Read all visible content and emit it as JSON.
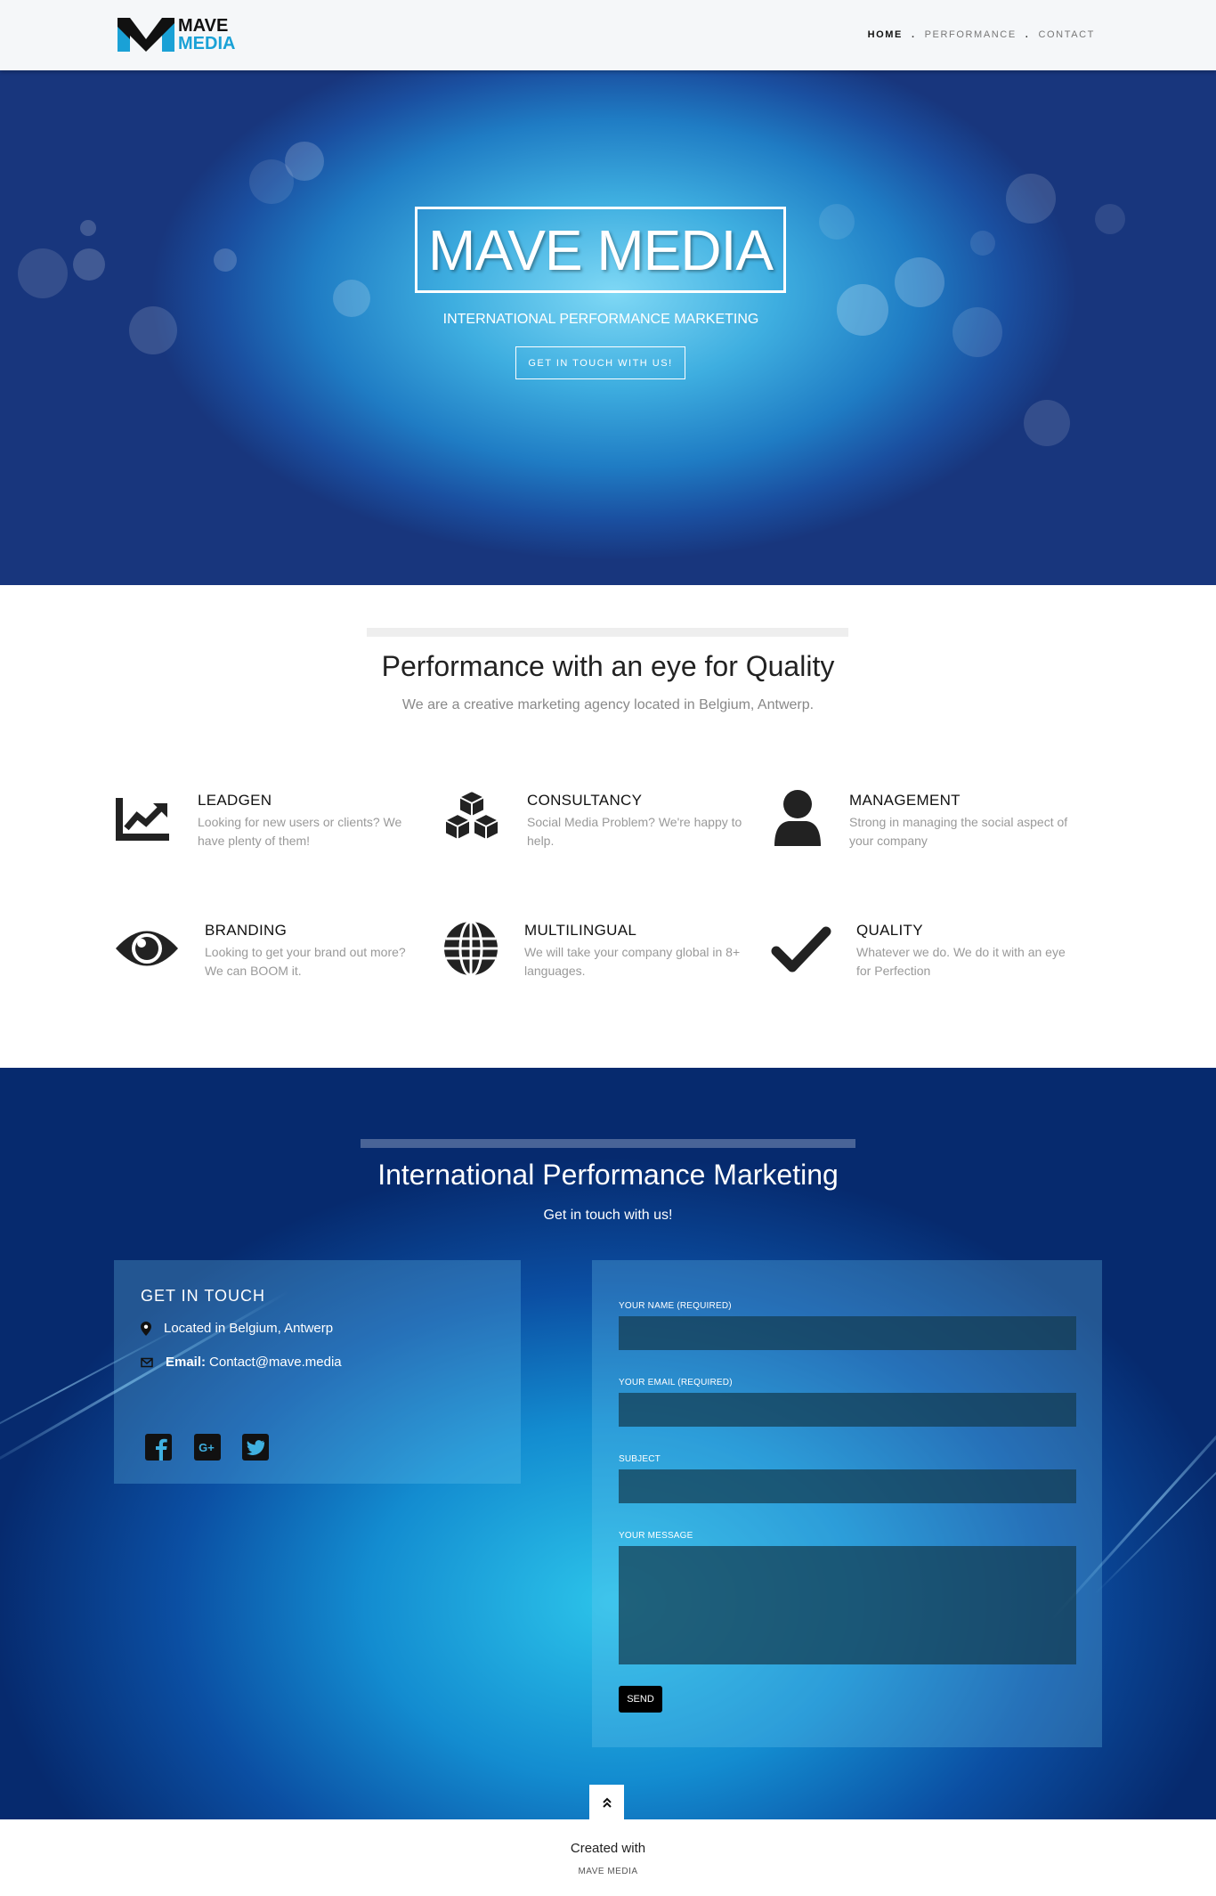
{
  "brand": {
    "logo_line1": "MAVE",
    "logo_line2": "MEDIA"
  },
  "nav": {
    "items": [
      {
        "label": "HOME",
        "active": true
      },
      {
        "label": "PERFORMANCE",
        "active": false
      },
      {
        "label": "CONTACT",
        "active": false
      }
    ],
    "separator": "."
  },
  "hero": {
    "title": "MAVE MEDIA",
    "subtitle": "INTERNATIONAL PERFORMANCE MARKETING",
    "cta_label": "GET IN TOUCH WITH US!"
  },
  "performance": {
    "title": "Performance with an eye for Quality",
    "subtitle": "We are a creative marketing agency located in Belgium, Antwerp.",
    "features": [
      {
        "icon": "chart-line-icon",
        "title": "LEADGEN",
        "text": "Looking for new users or clients? We have plenty of them!"
      },
      {
        "icon": "cubes-icon",
        "title": "CONSULTANCY",
        "text": "Social Media Problem? We're happy to help."
      },
      {
        "icon": "user-icon",
        "title": "MANAGEMENT",
        "text": "Strong in managing the social aspect of your company"
      },
      {
        "icon": "eye-icon",
        "title": "BRANDING",
        "text": "Looking to get your brand out more? We can BOOM it."
      },
      {
        "icon": "globe-icon",
        "title": "MULTILINGUAL",
        "text": "We will take your company global in 8+ languages."
      },
      {
        "icon": "checkmark-icon",
        "title": "QUALITY",
        "text": "Whatever we do. We do it with an eye for Perfection"
      }
    ]
  },
  "contact": {
    "title": "International Performance Marketing",
    "subtitle": "Get in touch with us!",
    "info": {
      "heading": "GET IN TOUCH",
      "location": "Located in Belgium, Antwerp",
      "email_label": "Email:",
      "email_value": "Contact@mave.media",
      "social": [
        "facebook-icon",
        "google-plus-icon",
        "twitter-icon"
      ]
    },
    "form": {
      "name_label": "YOUR NAME (REQUIRED)",
      "email_label": "YOUR EMAIL (REQUIRED)",
      "subject_label": "SUBJECT",
      "message_label": "YOUR MESSAGE",
      "name_value": "",
      "email_value": "",
      "subject_value": "",
      "message_value": "",
      "send_label": "SEND"
    }
  },
  "footer": {
    "created_with": "Created with",
    "brand": "MAVE MEDIA"
  },
  "colors": {
    "accent": "#1aa1d6",
    "nav_bg": "#f5f7f9",
    "hero_dark": "#18367d",
    "contact_dark": "#062a6e",
    "feature_text": "#999999"
  }
}
